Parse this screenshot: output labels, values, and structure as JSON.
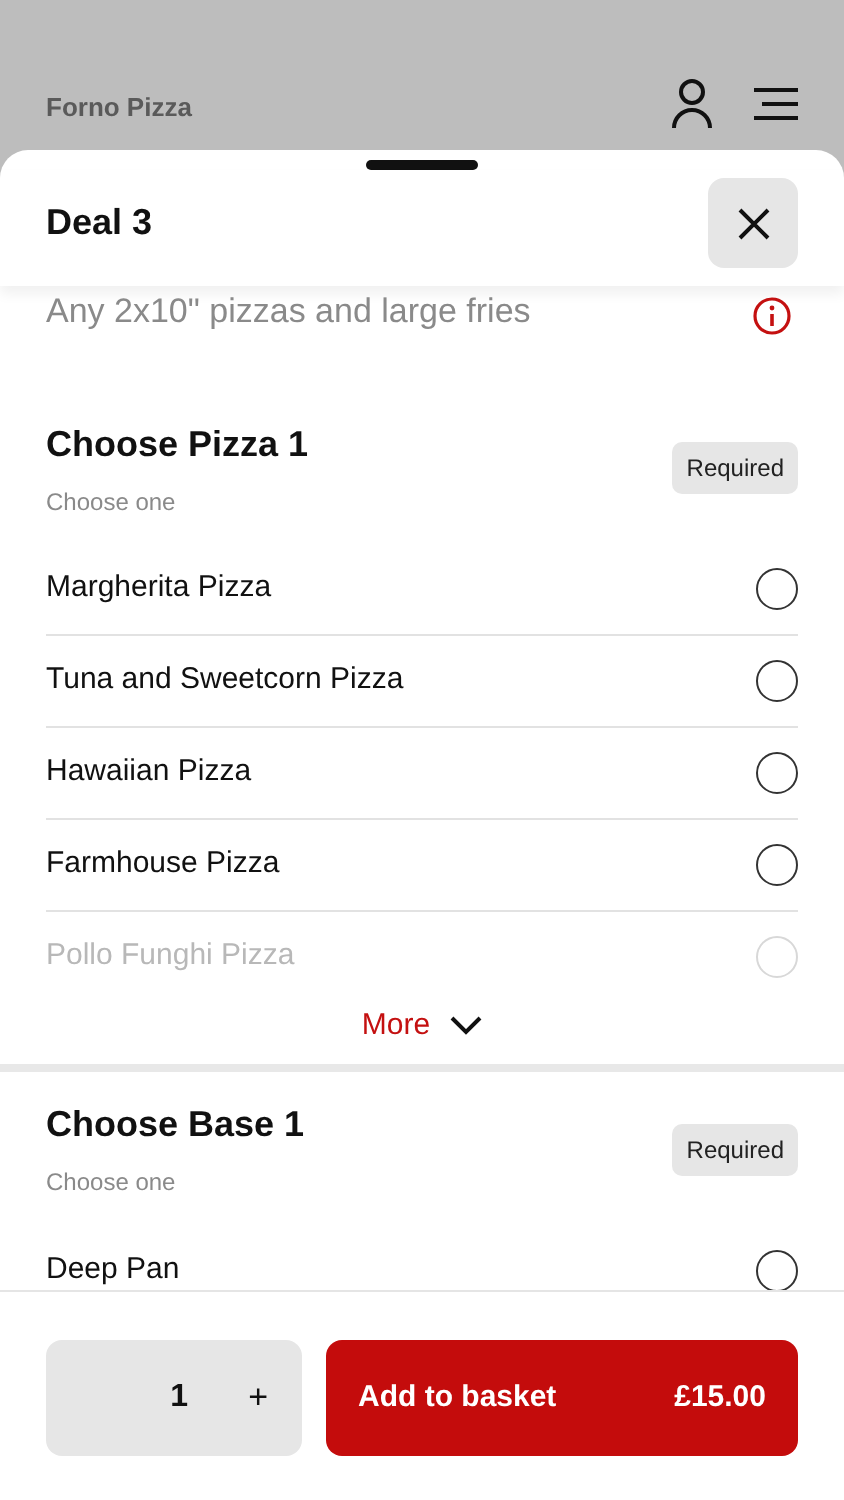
{
  "app_bar": {
    "title": "Forno Pizza"
  },
  "sheet": {
    "title": "Deal 3",
    "description": "Any 2x10\" pizzas and large fries"
  },
  "sections": [
    {
      "title": "Choose Pizza 1",
      "subtitle": "Choose one",
      "badge": "Required",
      "options": [
        {
          "label": "Margherita Pizza",
          "selected": false,
          "faded": false
        },
        {
          "label": "Tuna and Sweetcorn Pizza",
          "selected": false,
          "faded": false
        },
        {
          "label": "Hawaiian Pizza",
          "selected": false,
          "faded": false
        },
        {
          "label": "Farmhouse Pizza",
          "selected": false,
          "faded": false
        },
        {
          "label": "Pollo Funghi Pizza",
          "selected": false,
          "faded": true
        }
      ],
      "more": "More"
    },
    {
      "title": "Choose Base 1",
      "subtitle": "Choose one",
      "badge": "Required",
      "options": [
        {
          "label": "Deep Pan",
          "selected": false,
          "faded": false
        }
      ]
    }
  ],
  "footer": {
    "quantity": "1",
    "increment": "+",
    "add_button": "Add to basket",
    "price": "£15.00"
  }
}
